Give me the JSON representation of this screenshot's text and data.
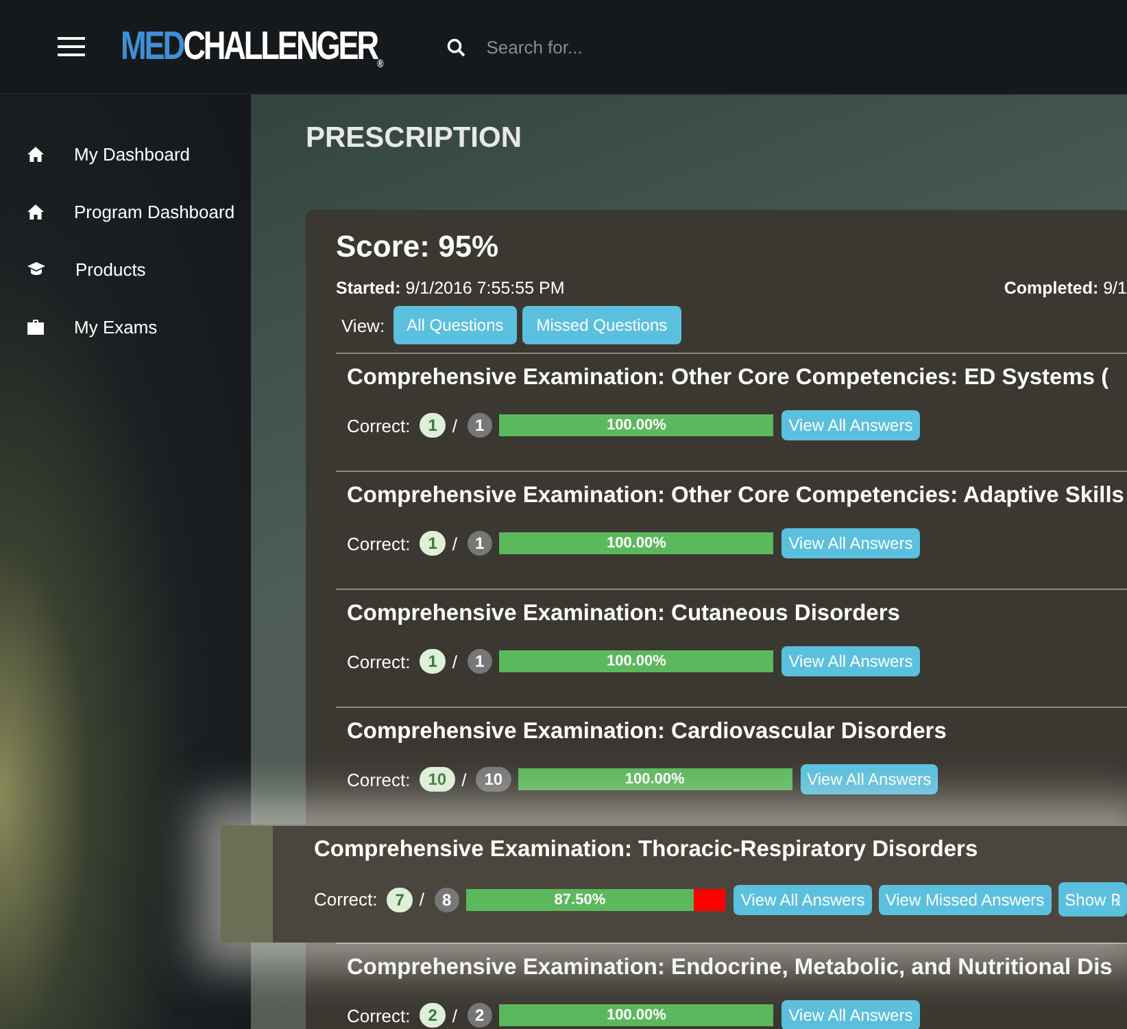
{
  "header": {
    "logo_left": "MED",
    "logo_right": "CHALLENGER",
    "logo_mark": "®",
    "search": {
      "placeholder": "Search for..."
    }
  },
  "sidebar": {
    "items": [
      {
        "label": "My Dashboard",
        "kind": "home"
      },
      {
        "label": "Program Dashboard",
        "kind": "home"
      },
      {
        "label": "Products",
        "kind": "cap"
      },
      {
        "label": "My Exams",
        "kind": "briefcase"
      }
    ]
  },
  "page_title": "PRESCRIPTION",
  "score": {
    "title": "Score: 95%",
    "started_label": "Started:",
    "started": "9/1/2016 7:55:55 PM",
    "completed_label": "Completed:",
    "completed": "9/1"
  },
  "view": {
    "label": "View:",
    "buttons": [
      "All Questions",
      "Missed Questions"
    ]
  },
  "sections": [
    {
      "title": "Comprehensive Examination: Other Core Competencies: ED Systems (",
      "correct_label": "Correct:",
      "separator": "/",
      "correct": "1",
      "total": "1",
      "level": 1,
      "percent": "100.00%",
      "buttons": [
        "View All Answers"
      ],
      "highlighted": false
    },
    {
      "title": "Comprehensive Examination: Other Core Competencies: Adaptive Skills",
      "correct_label": "Correct:",
      "separator": "/",
      "correct": "1",
      "total": "1",
      "level": 1,
      "percent": "100.00%",
      "buttons": [
        "View All Answers"
      ],
      "highlighted": false
    },
    {
      "title": "Comprehensive Examination: Cutaneous Disorders",
      "correct_label": "Correct:",
      "separator": "/",
      "correct": "1",
      "total": "1",
      "level": 1,
      "percent": "100.00%",
      "buttons": [
        "View All Answers"
      ],
      "highlighted": false
    },
    {
      "title": "Comprehensive Examination: Cardiovascular Disorders",
      "correct_label": "Correct:",
      "separator": "/",
      "correct": "10",
      "total": "10",
      "level": 1,
      "percent": "100.00%",
      "buttons": [
        "View All Answers"
      ],
      "highlighted": false
    },
    {
      "title": "Comprehensive Examination: Thoracic-Respiratory Disorders",
      "correct_label": "Correct:",
      "separator": "/",
      "correct": "7",
      "total": "8",
      "level": 0.875,
      "percent": "87.50%",
      "buttons": [
        "View All Answers",
        "View Missed Answers",
        "Show ℞"
      ],
      "highlighted": true
    },
    {
      "title": "Comprehensive Examination: Endocrine, Metabolic, and Nutritional Dis",
      "correct_label": "Correct:",
      "separator": "/",
      "correct": "2",
      "total": "2",
      "level": 1,
      "percent": "100.00%",
      "buttons": [
        "View All Answers"
      ],
      "highlighted": false
    }
  ]
}
